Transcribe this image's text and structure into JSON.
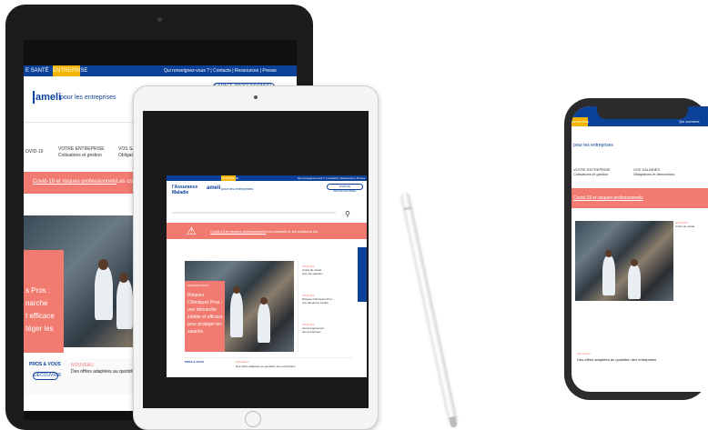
{
  "brand": {
    "logo_text": "ameli",
    "tagline": "pour les entreprises",
    "assurance_maladie": "l'Assurance Maladie"
  },
  "top_nav": {
    "sante_label": "E SANTÉ",
    "entreprise_tag": "ENTREPRISE",
    "links": "Qui renseignez-vous ? | Contacts | Ressources | Presse",
    "espace_button": "ESPACE PROFESSIONNEL"
  },
  "menu": {
    "covid": "OVID-19",
    "votre_entreprise": "VOTRE ENTREPRISE",
    "votre_entreprise_sub": "Cotisations et gestion",
    "vos_salaries": "VOS SALARIÉS",
    "vos_salaries_sub": "Obligations et démarches"
  },
  "alert": {
    "link": "Covid-19 et risques professionnels",
    "rest": "Les conseils et les solutions d'a"
  },
  "hero": {
    "big_lines": [
      "s Pros :",
      "narche",
      "t efficace",
      "téger les"
    ],
    "card_kicker": "RISQUES PROS",
    "card_lines": [
      "Risques",
      "Chimiques Pros :",
      "une démarche",
      "inédite et efficace",
      "pour protéger les",
      "salariés"
    ]
  },
  "news": {
    "label": "NOUVEAU",
    "text": "Des offres adaptées au quotidien des entreprises",
    "left_label": "PROS & VOUS",
    "left_button": "DÉCOUVRIR"
  },
  "side_items": [
    {
      "kicker": "RISQUES",
      "lines": [
        "Arrêts de travail",
        "pour les salariés..."
      ]
    },
    {
      "kicker": "RISQUES",
      "lines": [
        "Risques Chimiques Pros :",
        "une démarche inédite"
      ]
    },
    {
      "kicker": "RISQUES",
      "lines": [
        "Accompagnement",
        "des entreprises"
      ]
    }
  ],
  "phone": {
    "tag": "ENTREPRISE",
    "corner": "Qui sommes"
  }
}
